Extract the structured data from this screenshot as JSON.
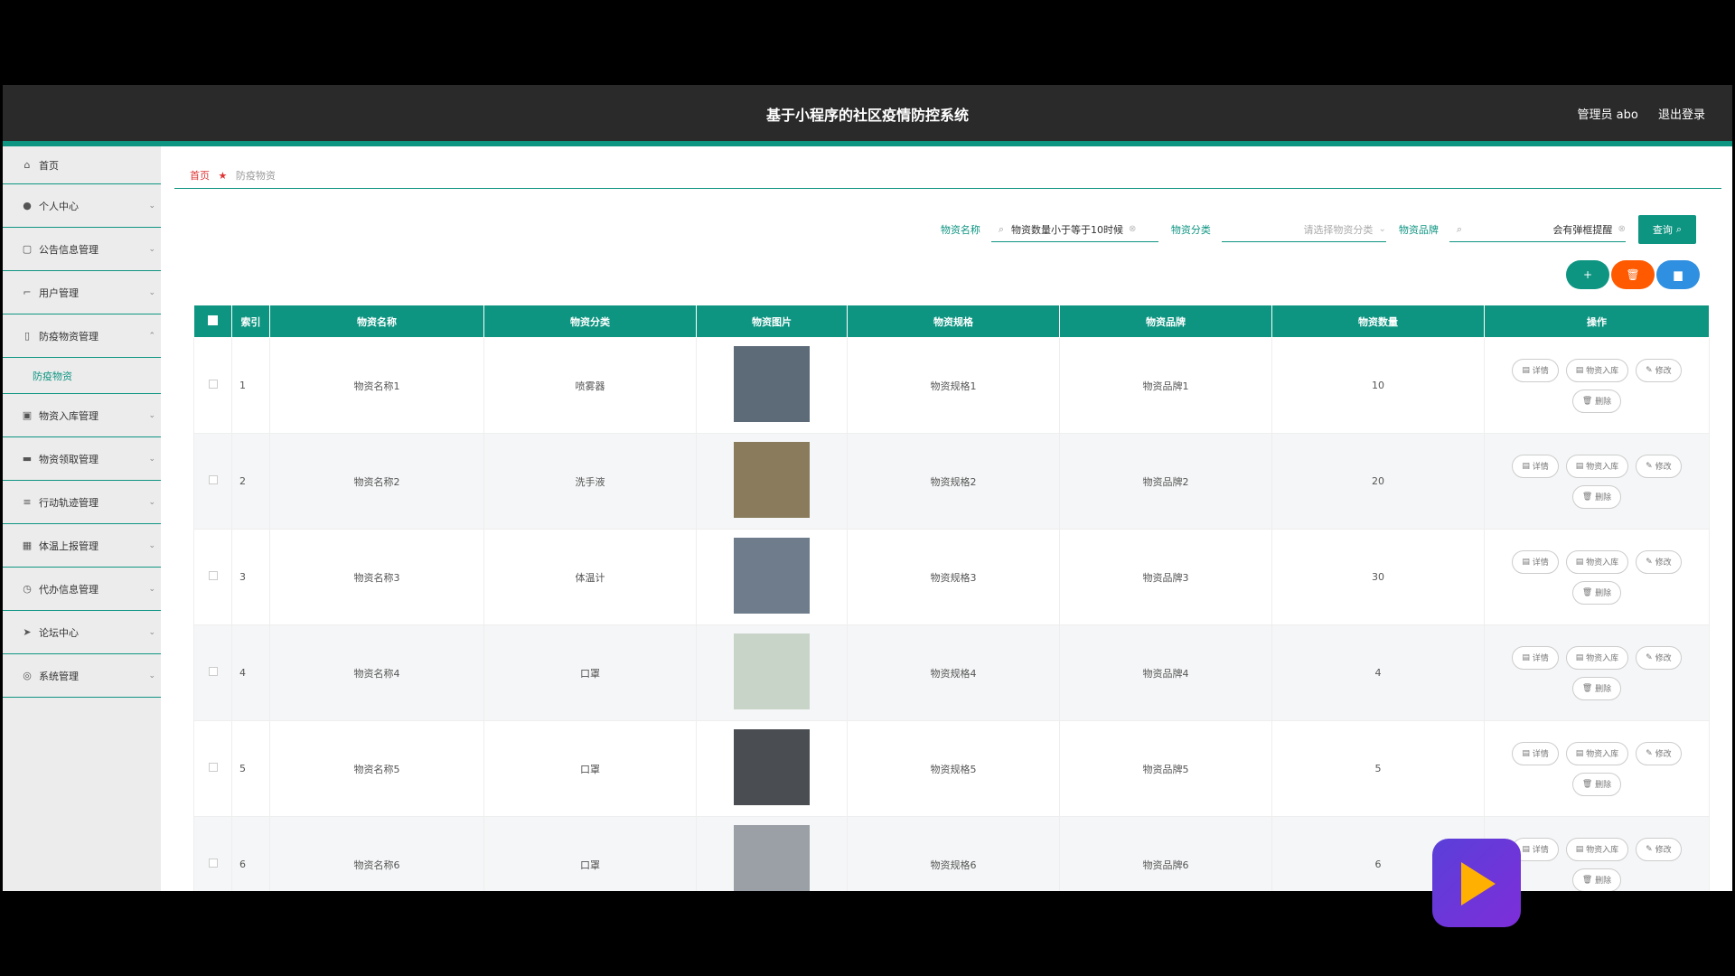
{
  "app": {
    "title": "基于小程序的社区疫情防控系统",
    "admin": "管理员 abo",
    "logout": "退出登录"
  },
  "sidebar": {
    "items": [
      {
        "label": "首页",
        "icon": "home-icon",
        "glyph": "⌂",
        "chev": ""
      },
      {
        "label": "个人中心",
        "icon": "user-icon",
        "glyph": "●",
        "chev": "⌄"
      },
      {
        "label": "公告信息管理",
        "icon": "copy-icon",
        "glyph": "▢",
        "chev": "⌄"
      },
      {
        "label": "用户管理",
        "icon": "crop-icon",
        "glyph": "⌐",
        "chev": "⌄"
      },
      {
        "label": "防疫物资管理",
        "icon": "phone-icon",
        "glyph": "▯",
        "chev": "⌃"
      },
      {
        "label": "物资入库管理",
        "icon": "inbox-icon",
        "glyph": "▣",
        "chev": "⌄"
      },
      {
        "label": "物资领取管理",
        "icon": "box-icon",
        "glyph": "▬",
        "chev": "⌄"
      },
      {
        "label": "行动轨迹管理",
        "icon": "list-icon",
        "glyph": "≡",
        "chev": "⌄"
      },
      {
        "label": "体温上报管理",
        "icon": "grid-icon",
        "glyph": "▦",
        "chev": "⌄"
      },
      {
        "label": "代办信息管理",
        "icon": "clock-icon",
        "glyph": "◷",
        "chev": "⌄"
      },
      {
        "label": "论坛中心",
        "icon": "send-icon",
        "glyph": "➤",
        "chev": "⌄"
      },
      {
        "label": "系统管理",
        "icon": "settings-icon",
        "glyph": "◎",
        "chev": "⌄"
      }
    ],
    "sub": "防疫物资"
  },
  "breadcrumb": {
    "home": "首页",
    "current": "防疫物资"
  },
  "search": {
    "name_label": "物资名称",
    "name_value": "物资数量小于等于10时候",
    "category_label": "物资分类",
    "category_placeholder": "请选择物资分类",
    "brand_label": "物资品牌",
    "brand_value": "会有弹框提醒",
    "query_label": "查询"
  },
  "actions": {
    "add": "+",
    "delete": "🗑",
    "stats": "▆"
  },
  "table": {
    "headers": [
      "索引",
      "物资名称",
      "物资分类",
      "物资图片",
      "物资规格",
      "物资品牌",
      "物资数量",
      "操作"
    ],
    "op_labels": {
      "detail": "详情",
      "stock_in": "物资入库",
      "edit": "修改",
      "delete": "删除"
    },
    "rows": [
      {
        "index": "1",
        "name": "物资名称1",
        "category": "喷雾器",
        "spec": "物资规格1",
        "brand": "物资品牌1",
        "qty": "10",
        "img": "#5d6a78"
      },
      {
        "index": "2",
        "name": "物资名称2",
        "category": "洗手液",
        "spec": "物资规格2",
        "brand": "物资品牌2",
        "qty": "20",
        "img": "#8a7b5c"
      },
      {
        "index": "3",
        "name": "物资名称3",
        "category": "体温计",
        "spec": "物资规格3",
        "brand": "物资品牌3",
        "qty": "30",
        "img": "#6f7c8c"
      },
      {
        "index": "4",
        "name": "物资名称4",
        "category": "口罩",
        "spec": "物资规格4",
        "brand": "物资品牌4",
        "qty": "4",
        "img": "#c9d4c9"
      },
      {
        "index": "5",
        "name": "物资名称5",
        "category": "口罩",
        "spec": "物资规格5",
        "brand": "物资品牌5",
        "qty": "5",
        "img": "#4a4e52"
      },
      {
        "index": "6",
        "name": "物资名称6",
        "category": "口罩",
        "spec": "物资规格6",
        "brand": "物资品牌6",
        "qty": "6",
        "img": "#9aa0a6"
      }
    ]
  },
  "colors": {
    "accent": "#0e9582",
    "danger": "#ff5a00",
    "info": "#2f8fe0"
  }
}
